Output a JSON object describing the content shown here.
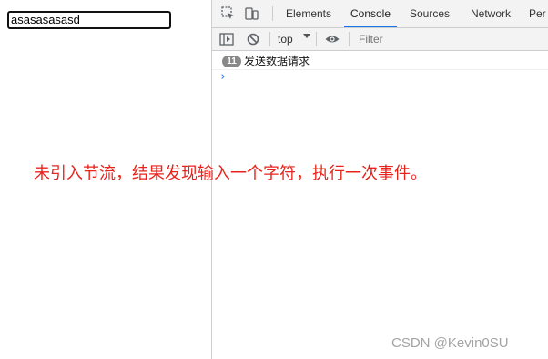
{
  "page": {
    "input_value": "asasasasasd"
  },
  "devtools": {
    "tabs": [
      {
        "label": "Elements"
      },
      {
        "label": "Console"
      },
      {
        "label": "Sources"
      },
      {
        "label": "Network"
      },
      {
        "label": "Per"
      }
    ],
    "active_tab": "Console",
    "toolbar": {
      "context_label": "top",
      "filter_placeholder": "Filter"
    },
    "console": {
      "messages": [
        {
          "count": "11",
          "text": "发送数据请求"
        }
      ],
      "prompt_symbol": "›"
    },
    "accent_color": "#1a73e8"
  },
  "annotation": {
    "text": "未引入节流，结果发现输入一个字符，执行一次事件。",
    "color": "#e8231c"
  },
  "watermark": {
    "text": "CSDN @Kevin0SU"
  },
  "icons": [
    "inspect-element-icon",
    "device-toggle-icon",
    "sidebar-toggle-icon",
    "clear-console-icon",
    "eye-icon",
    "chevron-down-icon"
  ]
}
